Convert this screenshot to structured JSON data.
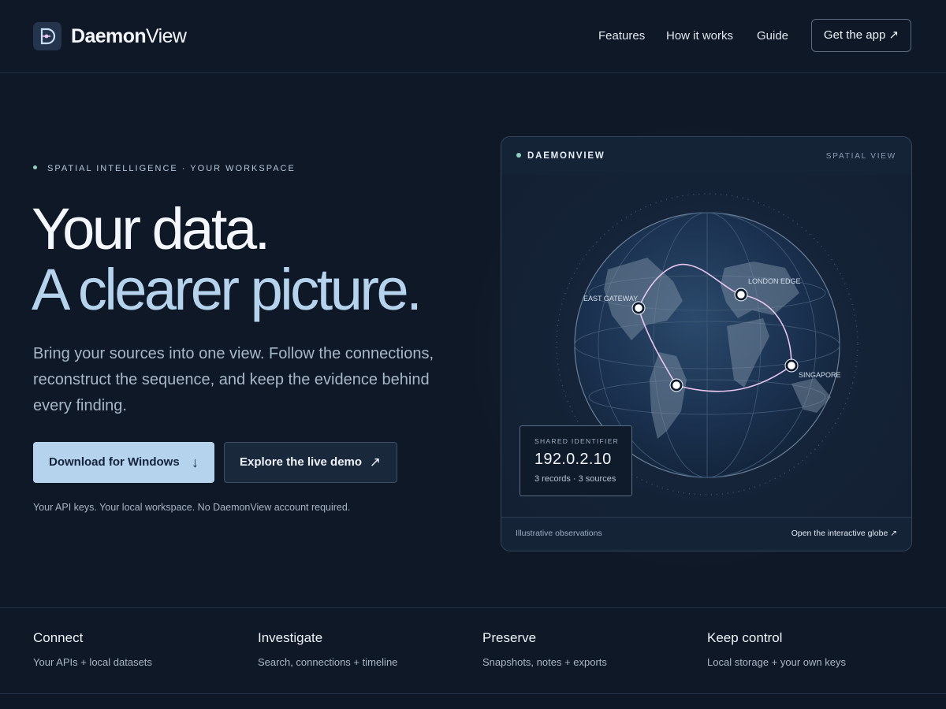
{
  "brand": {
    "name_bold": "Daemon",
    "name_light": "View"
  },
  "nav": {
    "items": [
      "Features",
      "How it works",
      "Guide"
    ],
    "cta": "Get the app ↗"
  },
  "hero": {
    "eyebrow": "SPATIAL INTELLIGENCE · YOUR WORKSPACE",
    "headline_1": "Your data.",
    "headline_2": "A clearer picture.",
    "lede": "Bring your sources into one view. Follow the connections, reconstruct the sequence, and keep the evidence behind every finding.",
    "primary_button": "Download for Windows",
    "primary_icon": "↓",
    "secondary_button": "Explore the live demo",
    "secondary_icon": "↗",
    "fineprint": "Your API keys. Your local workspace. No DaemonView account required."
  },
  "card": {
    "title": "DAEMONVIEW",
    "subtitle": "SPATIAL VIEW",
    "nodes": [
      "EAST GATEWAY",
      "LONDON EDGE",
      "SINGAPORE"
    ],
    "identifier_label": "SHARED IDENTIFIER",
    "identifier_value": "192.0.2.10",
    "identifier_meta": "3 records · 3 sources",
    "footer_left": "Illustrative observations",
    "footer_right": "Open the interactive globe ↗"
  },
  "features": [
    {
      "title": "Connect",
      "desc": "Your APIs + local datasets"
    },
    {
      "title": "Investigate",
      "desc": "Search, connections + timeline"
    },
    {
      "title": "Preserve",
      "desc": "Snapshots, notes + exports"
    },
    {
      "title": "Keep control",
      "desc": "Local storage + your own keys"
    }
  ],
  "colors": {
    "accent": "#b6d3ee",
    "background": "#0f1826",
    "status_dot": "#8fcfbd",
    "route": "#e8c6ee"
  }
}
